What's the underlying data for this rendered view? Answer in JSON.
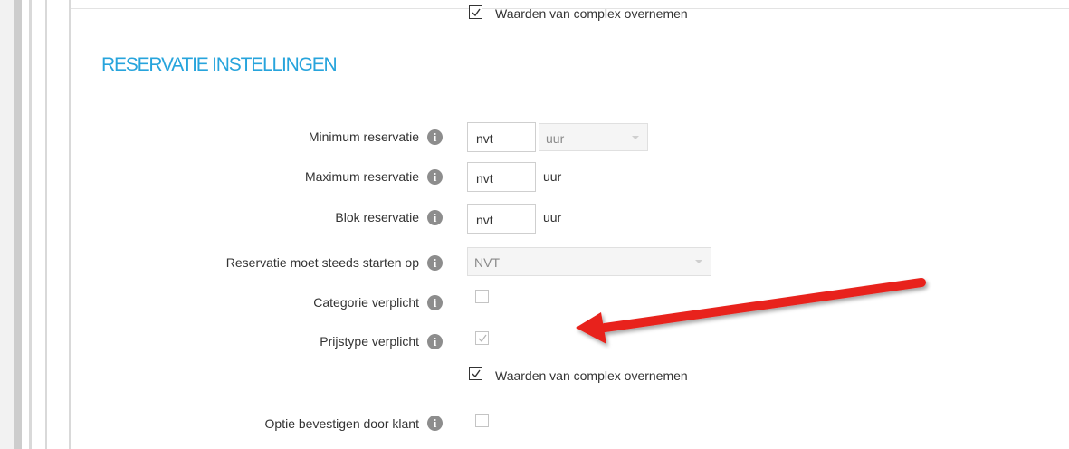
{
  "section": {
    "title": "RESERVATIE INSTELLINGEN",
    "top_checkbox_label": "Waarden van complex overnemen"
  },
  "fields": {
    "min": {
      "label": "Minimum reservatie",
      "value": "nvt",
      "unit": "uur"
    },
    "max": {
      "label": "Maximum reservatie",
      "value": "nvt",
      "unit": "uur"
    },
    "blok": {
      "label": "Blok reservatie",
      "value": "nvt",
      "unit": "uur"
    },
    "start": {
      "label": "Reservatie moet steeds starten op",
      "value": "NVT"
    },
    "categorie": {
      "label": "Categorie verplicht",
      "checked": false
    },
    "prijstype": {
      "label": "Prijstype verplicht",
      "checked": true,
      "disabled": true
    },
    "complex": {
      "label": "Waarden van complex overnemen",
      "checked": true
    },
    "optie": {
      "label": "Optie bevestigen door klant",
      "checked": false
    }
  },
  "icons": {
    "info": "info-icon",
    "info_glyph": "i",
    "arrow": "red-arrow-annotation"
  },
  "colors": {
    "accent": "#27a4dc",
    "arrow": "#e8201a",
    "icon": "#8d8d8d"
  }
}
